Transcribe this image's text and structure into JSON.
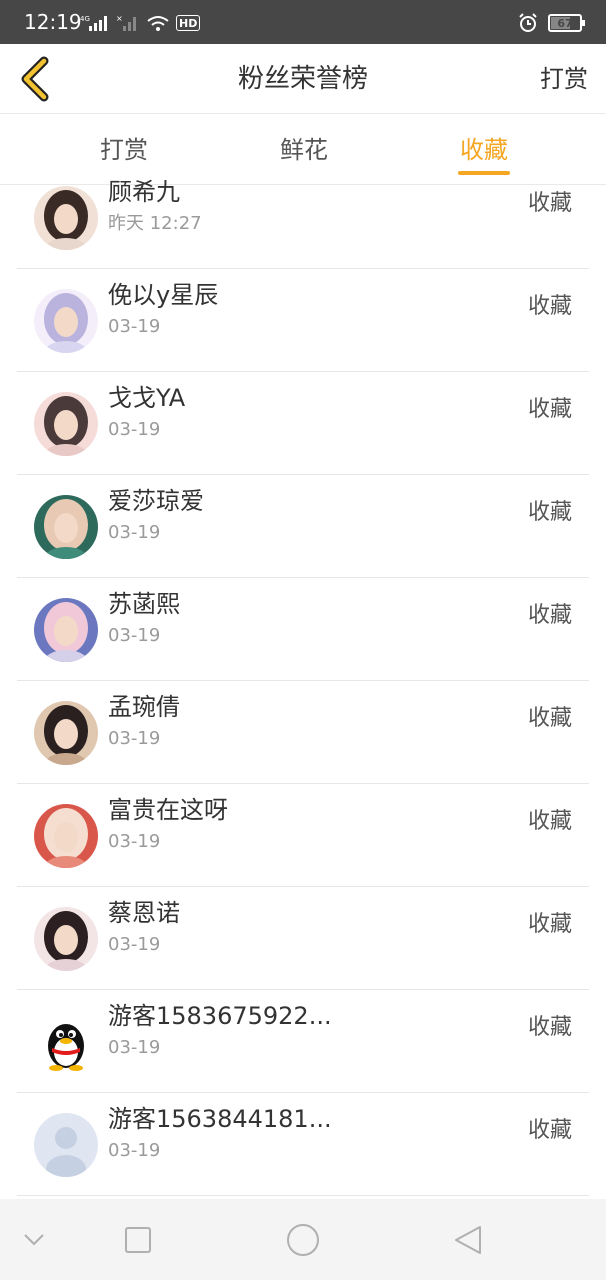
{
  "status_bar": {
    "time": "12:19",
    "network_label": "4G",
    "hd_label": "HD",
    "battery": "67",
    "battery_level": 0.67
  },
  "header": {
    "title": "粉丝荣誉榜",
    "back_icon": "chevron-left-icon",
    "action_label": "打赏"
  },
  "tabs": [
    {
      "label": "打赏",
      "active": false
    },
    {
      "label": "鲜花",
      "active": false
    },
    {
      "label": "收藏",
      "active": true
    }
  ],
  "colors": {
    "accent": "#f5a623",
    "status_bar_bg": "#474747",
    "text_primary": "#333333",
    "text_secondary": "#9a9a9a"
  },
  "fans": [
    {
      "name": "顾希九",
      "time": "昨天 12:27",
      "action": "收藏",
      "avatar": "photo-avatar"
    },
    {
      "name": "俛以y星辰",
      "time": "03-19",
      "action": "收藏",
      "avatar": "anime-avatar"
    },
    {
      "name": "戈戈YA",
      "time": "03-19",
      "action": "收藏",
      "avatar": "photo-avatar"
    },
    {
      "name": "爱莎琼爱",
      "time": "03-19",
      "action": "收藏",
      "avatar": "photo-avatar"
    },
    {
      "name": "苏菡熙",
      "time": "03-19",
      "action": "收藏",
      "avatar": "anime-avatar"
    },
    {
      "name": "孟琬倩",
      "time": "03-19",
      "action": "收藏",
      "avatar": "photo-avatar"
    },
    {
      "name": "富贵在这呀",
      "time": "03-19",
      "action": "收藏",
      "avatar": "photo-avatar"
    },
    {
      "name": "蔡恩诺",
      "time": "03-19",
      "action": "收藏",
      "avatar": "photo-avatar"
    },
    {
      "name": "游客1583675922...",
      "time": "03-19",
      "action": "收藏",
      "avatar": "penguin-avatar"
    },
    {
      "name": "游客1563844181...",
      "time": "03-19",
      "action": "收藏",
      "avatar": "default-avatar"
    }
  ],
  "navbar": {
    "buttons": [
      "chevron-down-icon",
      "square-icon",
      "circle-icon",
      "triangle-back-icon"
    ]
  }
}
